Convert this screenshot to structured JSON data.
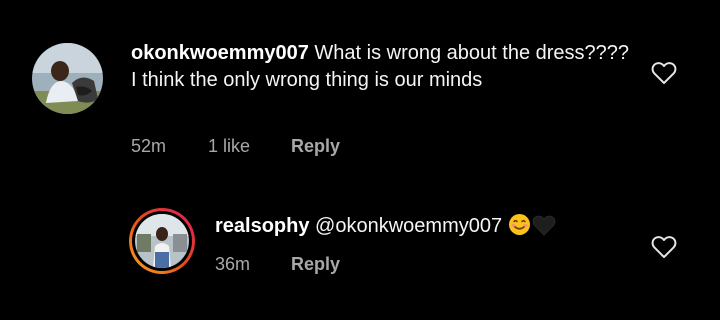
{
  "comments": [
    {
      "username": "okonkwoemmy007",
      "text": " What is wrong about the dress???? I think the only wrong thing is our minds",
      "time": "52m",
      "likes": "1 like",
      "reply_label": "Reply",
      "avatar_icon": "user-photo-avatar",
      "like_icon": "heart-outline-icon"
    },
    {
      "username": "realsophy",
      "text": " @okonkwoemmy007 ",
      "time": "36m",
      "reply_label": "Reply",
      "avatar_icon": "user-photo-avatar-story-ring",
      "emojis": [
        "smiling-face-emoji",
        "black-heart-emoji"
      ],
      "like_icon": "heart-outline-icon"
    }
  ],
  "colors": {
    "background": "#000000",
    "text": "#f5f5f5",
    "meta": "#a8a8a8",
    "story_ring_start": "#f9a825",
    "story_ring_end": "#d81b60"
  }
}
